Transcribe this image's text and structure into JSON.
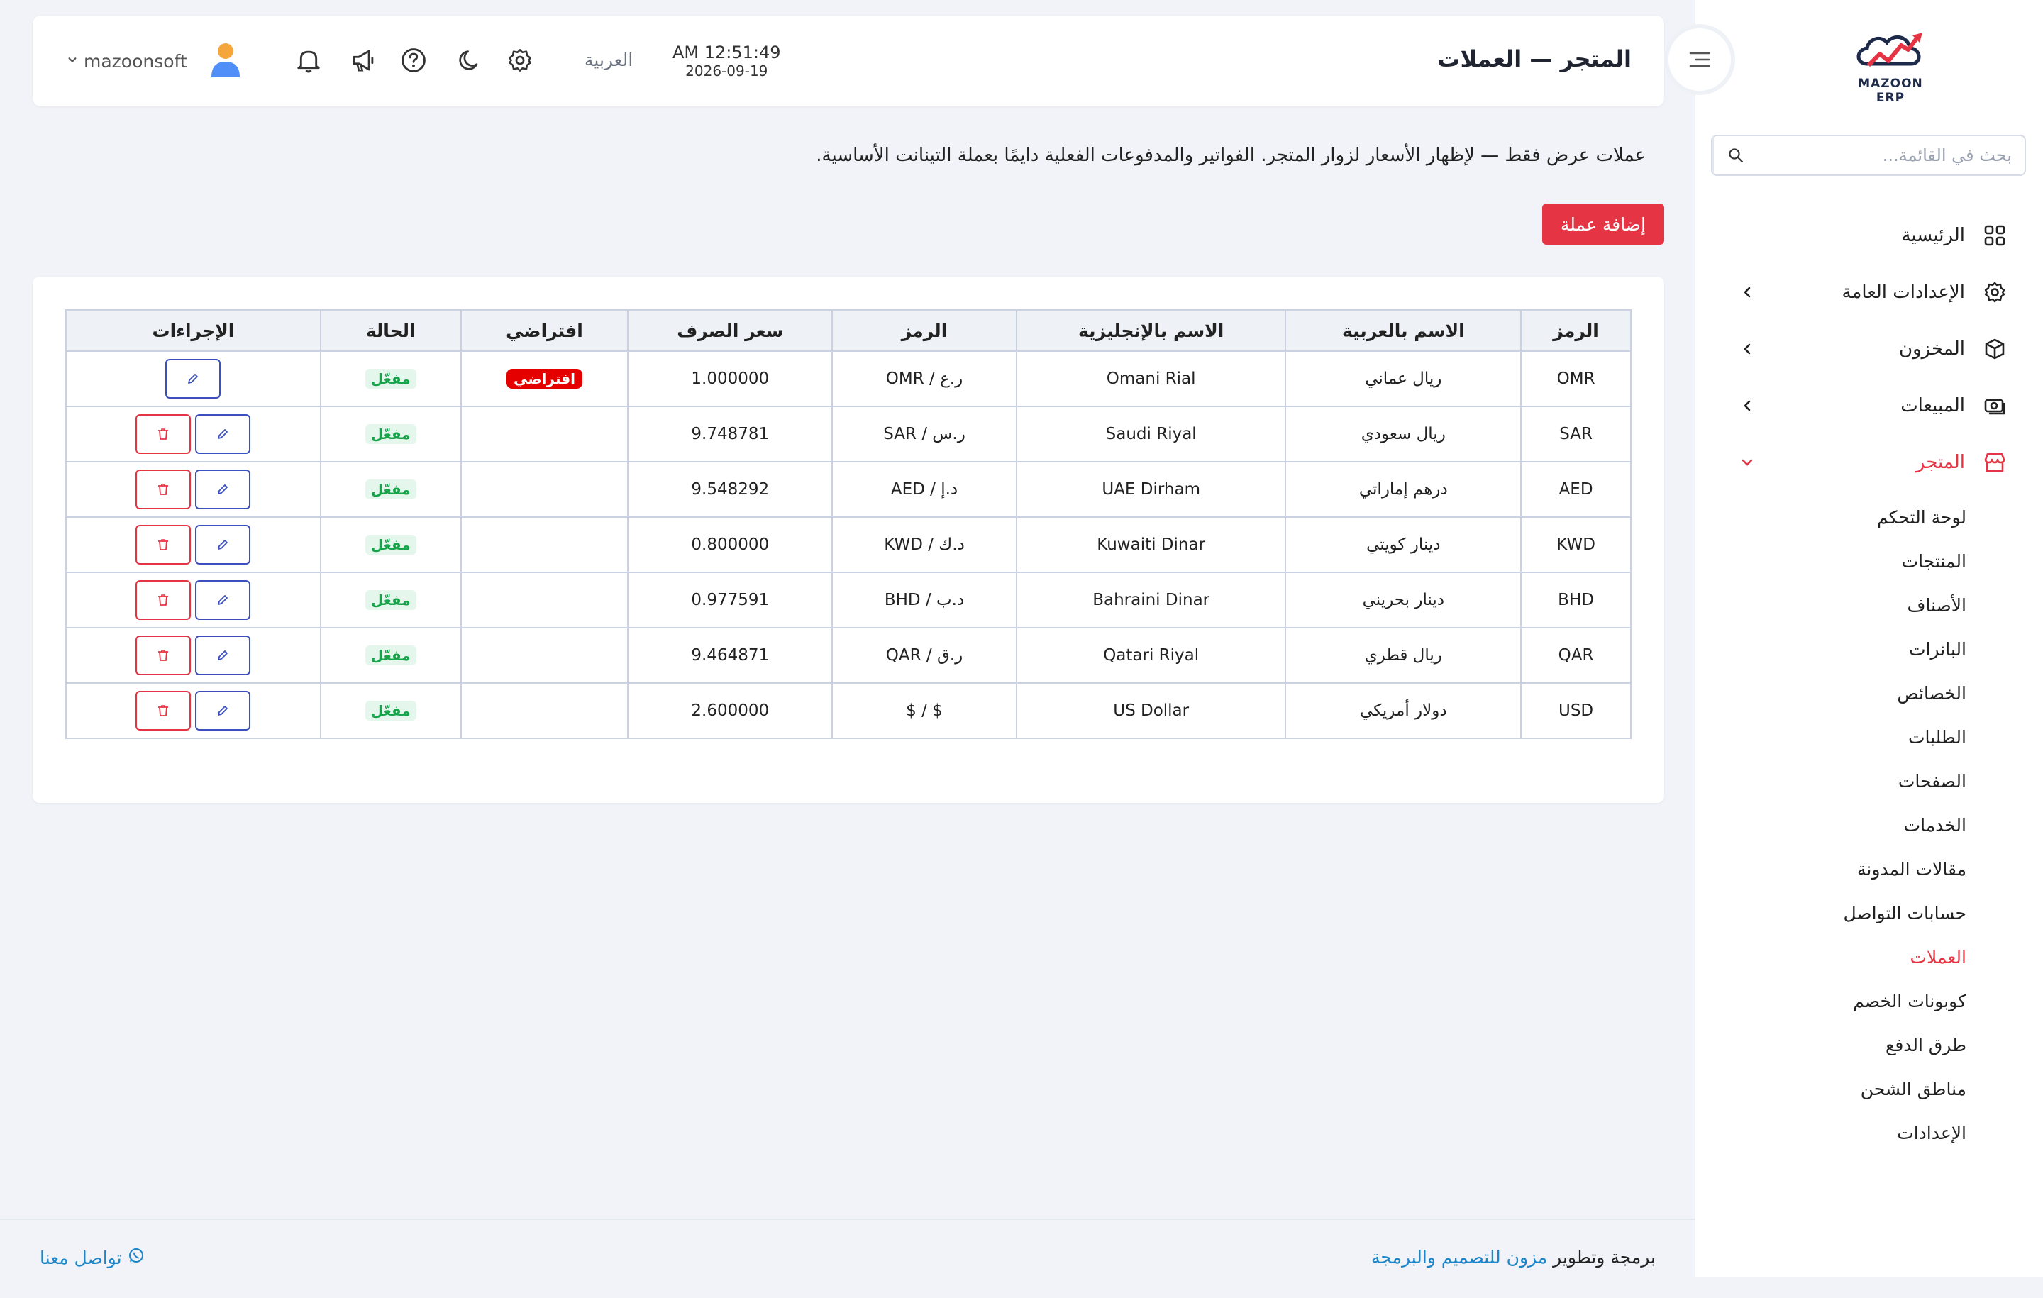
{
  "header": {
    "title": "المتجر — العملات",
    "time": "AM 12:51:49",
    "date": "2026-09-19",
    "language": "العربية",
    "username": "mazoonsoft"
  },
  "sidebar": {
    "logo_text": "MAZOON ERP",
    "search_placeholder": "بحث في القائمة...",
    "items": [
      {
        "label": "الرئيسية",
        "icon": "grid-icon"
      },
      {
        "label": "الإعدادات العامة",
        "icon": "gear-icon"
      },
      {
        "label": "المخزون",
        "icon": "box-icon"
      },
      {
        "label": "المبيعات",
        "icon": "cash-icon"
      },
      {
        "label": "المتجر",
        "icon": "store-icon"
      }
    ],
    "store_sub": [
      "لوحة التحكم",
      "المنتجات",
      "الأصناف",
      "البانرات",
      "الخصائص",
      "الطلبات",
      "الصفحات",
      "الخدمات",
      "مقالات المدونة",
      "حسابات التواصل",
      "العملات",
      "كوبونات الخصم",
      "طرق الدفع",
      "مناطق الشحن",
      "الإعدادات"
    ]
  },
  "main": {
    "info_text": "عملات عرض فقط — لإظهار الأسعار لزوار المتجر. الفواتير والمدفوعات الفعلية دايمًا بعملة التينانت الأساسية.",
    "add_button": "إضافة عملة",
    "table": {
      "headers": [
        "الرمز",
        "الاسم بالعربية",
        "الاسم بالإنجليزية",
        "الرمز",
        "سعر الصرف",
        "افتراضي",
        "الحالة",
        "الإجراءات"
      ],
      "status_label": "مفعّل",
      "default_label": "افتراضي",
      "rows": [
        {
          "code": "OMR",
          "name_ar": "ريال عماني",
          "name_en": "Omani Rial",
          "symbol": "ر.ع / OMR",
          "rate": "1.000000",
          "is_default": true
        },
        {
          "code": "SAR",
          "name_ar": "ريال سعودي",
          "name_en": "Saudi Riyal",
          "symbol": "ر.س / SAR",
          "rate": "9.748781",
          "is_default": false
        },
        {
          "code": "AED",
          "name_ar": "درهم إماراتي",
          "name_en": "UAE Dirham",
          "symbol": "د.إ / AED",
          "rate": "9.548292",
          "is_default": false
        },
        {
          "code": "KWD",
          "name_ar": "دينار كويتي",
          "name_en": "Kuwaiti Dinar",
          "symbol": "د.ك / KWD",
          "rate": "0.800000",
          "is_default": false
        },
        {
          "code": "BHD",
          "name_ar": "دينار بحريني",
          "name_en": "Bahraini Dinar",
          "symbol": "د.ب / BHD",
          "rate": "0.977591",
          "is_default": false
        },
        {
          "code": "QAR",
          "name_ar": "ريال قطري",
          "name_en": "Qatari Riyal",
          "symbol": "ر.ق / QAR",
          "rate": "9.464871",
          "is_default": false
        },
        {
          "code": "USD",
          "name_ar": "دولار أمريكي",
          "name_en": "US Dollar",
          "symbol": "$ / $",
          "rate": "2.600000",
          "is_default": false
        }
      ]
    }
  },
  "footer": {
    "credits_prefix": "برمجة وتطوير",
    "credits_link": "مزون للتصميم والبرمجة",
    "contact": "تواصل معنا"
  },
  "colors": {
    "accent": "#e53544",
    "edit": "#3b4fbf",
    "link": "#1c86c8",
    "active_status": "#17a34a"
  }
}
